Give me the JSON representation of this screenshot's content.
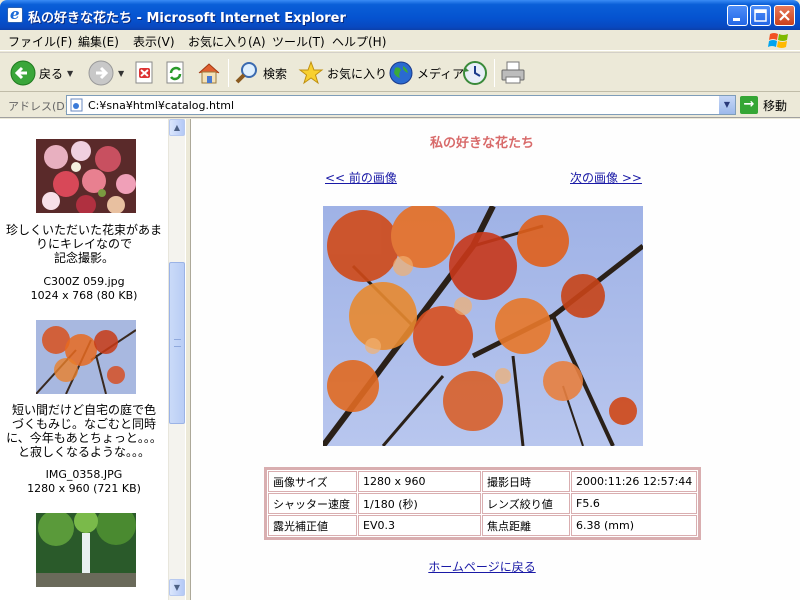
{
  "window": {
    "title": "私の好きな花たち - Microsoft Internet Explorer"
  },
  "menu": [
    "ファイル(F)",
    "編集(E)",
    "表示(V)",
    "お気に入り(A)",
    "ツール(T)",
    "ヘルプ(H)"
  ],
  "toolbar": {
    "back": "戻る",
    "search": "検索",
    "favorites": "お気に入り",
    "media": "メディア"
  },
  "address": {
    "label": "アドレス(D)",
    "url": "C:¥sna¥html¥catalog.html",
    "go": "移動"
  },
  "sidebar": {
    "items": [
      {
        "caption": [
          "珍しくいただいた花束があま",
          "りにキレイなので",
          "記念撮影。"
        ],
        "filename": "C300Z 059.jpg",
        "size": "1024 x 768 (80 KB)"
      },
      {
        "caption": [
          "短い間だけど自宅の庭で色",
          "づくもみじ。なごむと同時",
          "に、今年もあとちょっと。。。",
          "と寂しくなるような。。。"
        ],
        "filename": "IMG_0358.JPG",
        "size": "1280 x 960 (721 KB)"
      }
    ]
  },
  "page": {
    "title": "私の好きな花たち",
    "prev": "<< 前の画像",
    "next": "次の画像 >>",
    "home": "ホームページに戻る",
    "info": [
      [
        "画像サイズ",
        "1280 x 960",
        "撮影日時",
        "2000:11:26 12:57:44"
      ],
      [
        "シャッター速度",
        "1/180 (秒)",
        "レンズ絞り値",
        "F5.6"
      ],
      [
        "露光補正値",
        "EV0.3",
        "焦点距離",
        "6.38 (mm)"
      ]
    ]
  }
}
